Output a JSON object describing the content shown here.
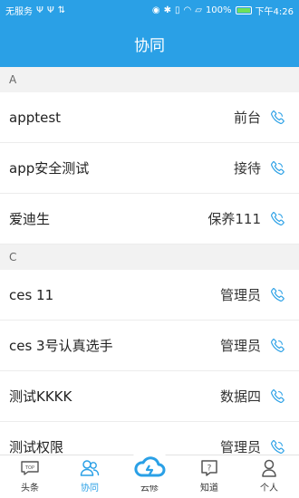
{
  "status_bar": {
    "carrier": "无服务",
    "battery_percent": "100%",
    "time": "下午4:26"
  },
  "title": "协同",
  "sections": [
    {
      "letter": "A",
      "items": [
        {
          "name": "apptest",
          "role": "前台"
        },
        {
          "name": "app安全测试",
          "role": "接待"
        },
        {
          "name": "爱迪生",
          "role": "保养111"
        }
      ]
    },
    {
      "letter": "C",
      "items": [
        {
          "name": "ces 11",
          "role": "管理员"
        },
        {
          "name": "ces 3号认真选手",
          "role": "管理员"
        },
        {
          "name": "测试KKKK",
          "role": "数据四"
        },
        {
          "name": "测试权限",
          "role": "管理员"
        }
      ]
    }
  ],
  "tabs": [
    {
      "label": "头条",
      "icon": "top-news-icon",
      "active": false
    },
    {
      "label": "协同",
      "icon": "contacts-icon",
      "active": true
    },
    {
      "label": "云修",
      "icon": "cloud-repair-icon",
      "active": false
    },
    {
      "label": "知道",
      "icon": "question-icon",
      "active": false
    },
    {
      "label": "个人",
      "icon": "person-icon",
      "active": false
    }
  ],
  "colors": {
    "accent": "#2aa0e6",
    "phone": "#2aa0e6"
  }
}
